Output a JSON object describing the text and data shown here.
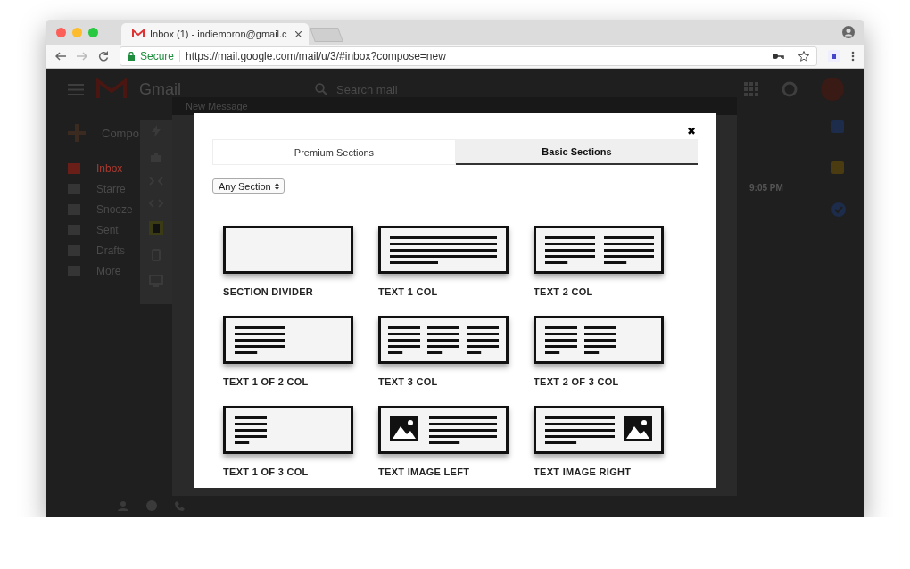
{
  "browser": {
    "tab_title": "Inbox (1) - indiemoron@gmail.c",
    "security": "Secure",
    "url": "https://mail.google.com/mail/u/3/#inbox?compose=new"
  },
  "gmail": {
    "logo_text": "Gmail",
    "search": {
      "placeholder": "Search mail"
    },
    "compose": "Compo",
    "nav": [
      {
        "label": "Inbox",
        "selected": true
      },
      {
        "label": "Starre",
        "selected": false
      },
      {
        "label": "Snooze",
        "selected": false
      },
      {
        "label": "Sent",
        "selected": false
      },
      {
        "label": "Drafts",
        "selected": false
      },
      {
        "label": "More",
        "selected": false
      }
    ],
    "time": "9:05 PM",
    "compose_window": {
      "title": "New Message"
    }
  },
  "modal": {
    "close": "✖",
    "tabs": [
      {
        "label": "Premium Sections",
        "selected": false
      },
      {
        "label": "Basic Sections",
        "selected": true
      }
    ],
    "filter": {
      "value": "Any Section"
    },
    "sections": [
      {
        "label": "SECTION DIVIDER",
        "kind": "blank"
      },
      {
        "label": "TEXT 1 COL",
        "kind": "text1"
      },
      {
        "label": "TEXT 2 COL",
        "kind": "text2"
      },
      {
        "label": "TEXT 1 OF 2 COL",
        "kind": "text1of2"
      },
      {
        "label": "TEXT 3 COL",
        "kind": "text3"
      },
      {
        "label": "TEXT 2 OF 3 COL",
        "kind": "text2of3"
      },
      {
        "label": "TEXT 1 OF 3 COL",
        "kind": "text1of3"
      },
      {
        "label": "TEXT IMAGE LEFT",
        "kind": "imageleft"
      },
      {
        "label": "TEXT IMAGE RIGHT",
        "kind": "imageright"
      }
    ]
  }
}
